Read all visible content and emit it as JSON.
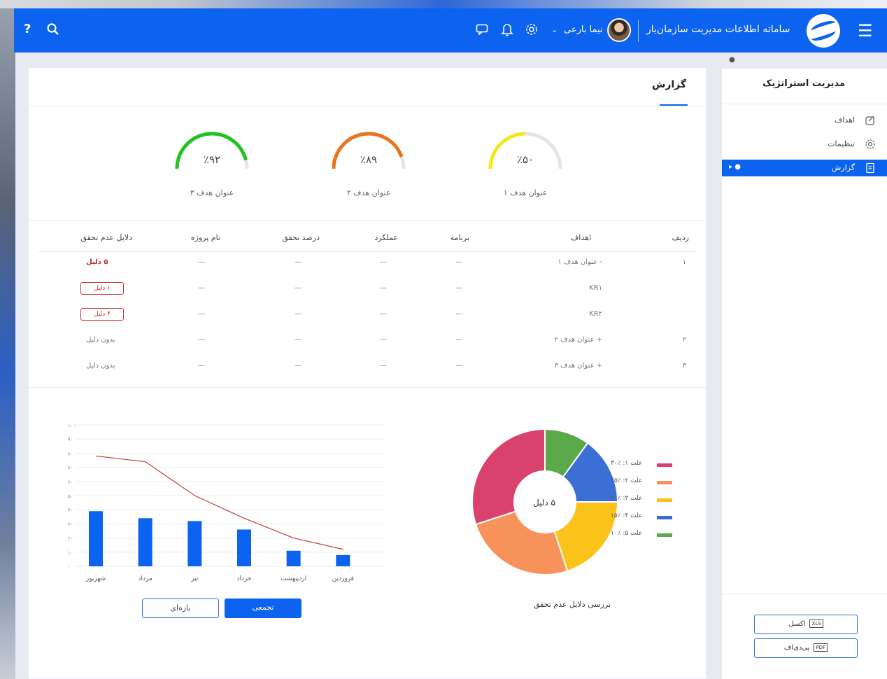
{
  "header": {
    "app_title": "ساماته اطلاعات مدیریت سازمان‌یار",
    "user_name": "نیما بارعی",
    "help_label": "?",
    "icons": [
      "menu-icon",
      "settings-icon",
      "bell-icon",
      "chat-icon",
      "search-icon",
      "help-icon"
    ]
  },
  "sidebar": {
    "pin": "●",
    "title": "مدیریت استراتژیک",
    "items": [
      {
        "label": "اهداف",
        "icon": "target-icon",
        "active": false
      },
      {
        "label": "تنظیمات",
        "icon": "gear-icon",
        "active": false
      },
      {
        "label": "گزارش",
        "icon": "report-icon",
        "active": true,
        "badge": "● ▸"
      }
    ],
    "exports": [
      {
        "label": "اکسل",
        "tag": "XLS"
      },
      {
        "label": "پی‌دی‌اف",
        "tag": "PDF"
      }
    ]
  },
  "main": {
    "tab_title": "گزارش",
    "gauges": [
      {
        "value": "٪۹۲",
        "label": "عنوان هدف ۳",
        "percent": 92,
        "color": "#1ec31e"
      },
      {
        "value": "٪۸۹",
        "label": "عنوان هدف ۲",
        "percent": 89,
        "color": "#e8741c"
      },
      {
        "value": "٪۵۰",
        "label": "عنوان هدف ۱",
        "percent": 50,
        "color": "#f2ea1f"
      }
    ],
    "table": {
      "headers": [
        "ردیف",
        "اهداف",
        "برنامه",
        "عملکرد",
        "درصد تحقق",
        "نام پروژه",
        "دلایل عدم تحقق"
      ],
      "rows": [
        {
          "idx": "۱",
          "goal": "- عنوان هدف ۱",
          "plan": "—",
          "perf": "—",
          "pct": "—",
          "proj": "—",
          "reason": "۵ دلیل",
          "reason_type": "red"
        },
        {
          "idx": "",
          "goal": "KR۱",
          "plan": "—",
          "perf": "—",
          "pct": "—",
          "proj": "—",
          "reason": "۱ دلیل",
          "reason_type": "button"
        },
        {
          "idx": "",
          "goal": "KR۲",
          "plan": "—",
          "perf": "—",
          "pct": "—",
          "proj": "—",
          "reason": "۴ دلیل",
          "reason_type": "button"
        },
        {
          "idx": "۲",
          "goal": "+ عنوان هدف ۲",
          "plan": "—",
          "perf": "—",
          "pct": "—",
          "proj": "—",
          "reason": "بدون دلیل",
          "reason_type": "text"
        },
        {
          "idx": "۳",
          "goal": "+ عنوان هدف ۳",
          "plan": "—",
          "perf": "—",
          "pct": "—",
          "proj": "—",
          "reason": "بدون دلیل",
          "reason_type": "text"
        }
      ]
    },
    "donut": {
      "title": "بررسی دلایل عدم تحقق",
      "center": "۵ دلیل"
    },
    "line_bar_buttons": {
      "cumulative": "تجمعی",
      "periodic": "بازه‌ای"
    }
  },
  "chart_data": [
    {
      "type": "pie",
      "title": "بررسی دلایل عدم تحقق",
      "center_label": "۵ دلیل",
      "categories": [
        "علت ۱",
        "علت ۲",
        "علت ۳",
        "علت ۴",
        "علت ۵"
      ],
      "legend": [
        "علت ۱: ٪۳۰",
        "علت ۲: ٪۲۵",
        "علت ۳: ٪۲۰",
        "علت ۴: ٪۱۵",
        "علت ۵: ٪۱۰"
      ],
      "values": [
        30,
        25,
        20,
        15,
        10
      ],
      "colors": [
        "#d9426e",
        "#f7935a",
        "#fbc21a",
        "#3b6fd4",
        "#5aa94a"
      ]
    },
    {
      "type": "bar",
      "categories": [
        "فروردین",
        "اردیبهشت",
        "خرداد",
        "تیر",
        "مرداد",
        "شهریور"
      ],
      "series": [
        {
          "type": "bar",
          "values": [
            8,
            11,
            26,
            32,
            34,
            39
          ],
          "color": "#0b63f0"
        },
        {
          "type": "line",
          "values": [
            12,
            20,
            34,
            50,
            74,
            78
          ],
          "color": "#c43a3a"
        }
      ],
      "y_ticks": [
        "۰",
        "۱۰",
        "۲۰",
        "۳۰",
        "۴۰",
        "۵۰",
        "۶۰",
        "۷۰",
        "۸۰",
        "۹۰",
        "۱۰۰"
      ],
      "ylim": [
        0,
        100
      ]
    }
  ]
}
